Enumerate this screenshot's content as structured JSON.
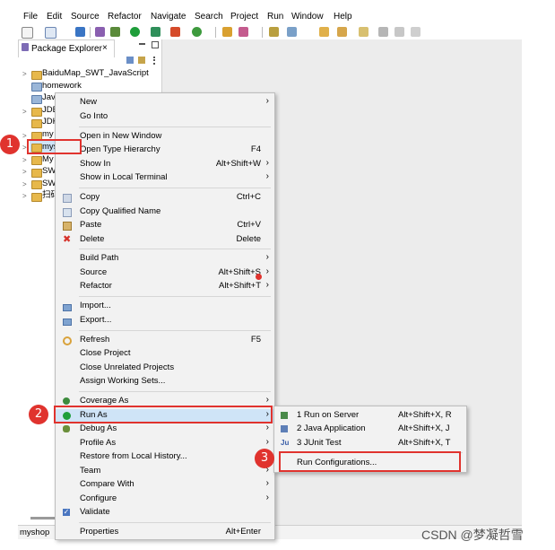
{
  "menubar": [
    "File",
    "Edit",
    "Source",
    "Refactor",
    "Navigate",
    "Search",
    "Project",
    "Run",
    "Window",
    "Help"
  ],
  "explorer": {
    "tab_label": "Package Explorer",
    "tab_close": "×",
    "tree": [
      {
        "arrow": ">",
        "label": "BaiduMap_SWT_JavaScript"
      },
      {
        "arrow": "",
        "label": "homework"
      },
      {
        "arrow": "",
        "label": "Java"
      },
      {
        "arrow": ">",
        "label": "JDB"
      },
      {
        "arrow": "",
        "label": "JDK"
      },
      {
        "arrow": ">",
        "label": "my"
      },
      {
        "arrow": ">",
        "label": "mys"
      },
      {
        "arrow": ">",
        "label": "My"
      },
      {
        "arrow": ">",
        "label": "SW"
      },
      {
        "arrow": ">",
        "label": "SW"
      },
      {
        "arrow": ">",
        "label": "扫码"
      }
    ]
  },
  "context_menu": {
    "new": {
      "label": "New"
    },
    "go_into": {
      "label": "Go Into"
    },
    "open_new_window": {
      "label": "Open in New Window"
    },
    "open_type_hierarchy": {
      "label": "Open Type Hierarchy",
      "shortcut": "F4"
    },
    "show_in": {
      "label": "Show In",
      "shortcut": "Alt+Shift+W"
    },
    "show_in_terminal": {
      "label": "Show in Local Terminal"
    },
    "copy": {
      "label": "Copy",
      "shortcut": "Ctrl+C"
    },
    "copy_qualified": {
      "label": "Copy Qualified Name"
    },
    "paste": {
      "label": "Paste",
      "shortcut": "Ctrl+V"
    },
    "delete": {
      "label": "Delete",
      "shortcut": "Delete"
    },
    "build_path": {
      "label": "Build Path"
    },
    "source": {
      "label": "Source",
      "shortcut": "Alt+Shift+S"
    },
    "refactor": {
      "label": "Refactor",
      "shortcut": "Alt+Shift+T"
    },
    "import": {
      "label": "Import..."
    },
    "export": {
      "label": "Export..."
    },
    "refresh": {
      "label": "Refresh",
      "shortcut": "F5"
    },
    "close_project": {
      "label": "Close Project"
    },
    "close_unrelated": {
      "label": "Close Unrelated Projects"
    },
    "assign_working_sets": {
      "label": "Assign Working Sets..."
    },
    "coverage_as": {
      "label": "Coverage As"
    },
    "run_as": {
      "label": "Run As"
    },
    "debug_as": {
      "label": "Debug As"
    },
    "profile_as": {
      "label": "Profile As"
    },
    "restore_history": {
      "label": "Restore from Local History..."
    },
    "team": {
      "label": "Team"
    },
    "compare_with": {
      "label": "Compare With"
    },
    "configure": {
      "label": "Configure"
    },
    "validate": {
      "label": "Validate"
    },
    "properties": {
      "label": "Properties",
      "shortcut": "Alt+Enter"
    },
    "arrow": "›"
  },
  "submenu": {
    "run_on_server": {
      "label": "1 Run on Server",
      "shortcut": "Alt+Shift+X, R"
    },
    "java_app": {
      "label": "2 Java Application",
      "shortcut": "Alt+Shift+X, J"
    },
    "junit": {
      "label": "3 JUnit Test",
      "shortcut": "Alt+Shift+X, T"
    },
    "run_configs": {
      "label": "Run Configurations..."
    }
  },
  "status": {
    "selection": "myshop"
  },
  "annotations": [
    "1",
    "2",
    "3"
  ],
  "watermark": "CSDN @梦凝哲雪",
  "colors": {
    "highlight": "#cfe4f7",
    "annotation_red": "#e0332e",
    "menu_bg": "#f2f2f2"
  }
}
